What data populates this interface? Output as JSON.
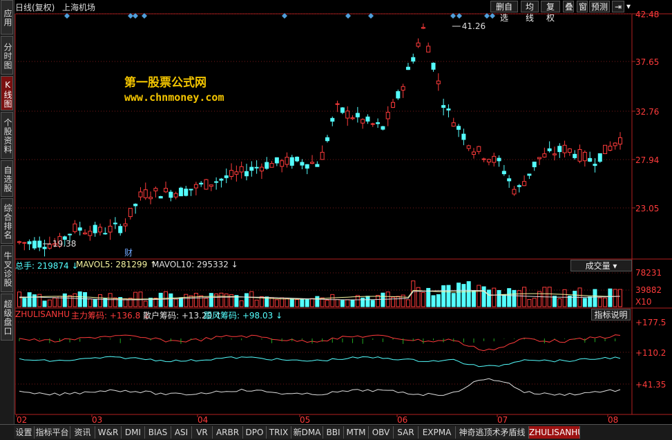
{
  "header": {
    "title": "日线(复权)",
    "stock_name": "上海机场",
    "buttons": [
      "删自选",
      "均线",
      "复权",
      "叠",
      "窗",
      "预测"
    ],
    "nav_icon": "arrow-left-bar-icon",
    "dropdown_icon": "triangle-down-icon"
  },
  "sidebar": {
    "tabs": [
      {
        "label": "应用",
        "active": false
      },
      {
        "label": "分时图",
        "active": false
      },
      {
        "label": "K线图",
        "active": true
      },
      {
        "label": "个股资料",
        "active": false
      },
      {
        "label": "自选股",
        "active": false
      },
      {
        "label": "综合排名",
        "active": false
      },
      {
        "label": "牛叉诊股",
        "active": false
      },
      {
        "label": "超级盘口",
        "active": false
      }
    ]
  },
  "watermark": {
    "line1": "第一股票公式网",
    "line2": "www.chnmoney.com"
  },
  "price_panel": {
    "axis_labels": [
      "42.48",
      "37.65",
      "32.76",
      "27.94",
      "23.05"
    ],
    "high_label": "41.26",
    "low_label": "19.38",
    "event_marker": "财",
    "colors": {
      "up": "#ff3b3b",
      "down": "#54ffff",
      "diamond": "#4f9fdc"
    }
  },
  "volume_panel": {
    "legend": [
      {
        "label": "总手: 219874",
        "arrow": "down",
        "color": "#54ffff"
      },
      {
        "label": "MAVOL5: 281299",
        "arrow": "up",
        "color": "#f5f5a0"
      },
      {
        "label": "MAVOL10: 295332",
        "arrow": "down",
        "color": "#e0e0e0"
      }
    ],
    "selector_label": "成交量",
    "axis_labels": [
      "78231",
      "39882",
      "X10"
    ]
  },
  "indicator_panel": {
    "name": "ZHULISANHU",
    "legend": [
      {
        "label": "主力筹码: +136.8",
        "arrow": "down",
        "color": "#ff3b3b"
      },
      {
        "label": "散户筹码: +13.20",
        "arrow": "up",
        "color": "#e0e0e0"
      },
      {
        "label": "跟风筹码: +98.03",
        "arrow": "down",
        "color": "#54ffff"
      }
    ],
    "help_button": "指标说明",
    "axis_labels": [
      "+177.5",
      "+110.2",
      "+41.35"
    ]
  },
  "time_axis": [
    "02",
    "03",
    "04",
    "05",
    "06",
    "07",
    "08"
  ],
  "bottom_tabs": [
    {
      "label": "设置",
      "active": false
    },
    {
      "label": "指标平台",
      "active": false
    },
    {
      "label": "资讯",
      "active": false
    },
    {
      "label": "W&R",
      "active": false
    },
    {
      "label": "DMI",
      "active": false
    },
    {
      "label": "BIAS",
      "active": false
    },
    {
      "label": "ASI",
      "active": false
    },
    {
      "label": "VR",
      "active": false
    },
    {
      "label": "ARBR",
      "active": false
    },
    {
      "label": "DPO",
      "active": false
    },
    {
      "label": "TRIX",
      "active": false
    },
    {
      "label": "新DMA",
      "active": false
    },
    {
      "label": "BBI",
      "active": false
    },
    {
      "label": "MTM",
      "active": false
    },
    {
      "label": "OBV",
      "active": false
    },
    {
      "label": "SAR",
      "active": false
    },
    {
      "label": "EXPMA",
      "active": false
    },
    {
      "label": "神奇逃顶术矛盾线",
      "active": false
    },
    {
      "label": "ZHULISANHU",
      "active": true
    }
  ]
}
